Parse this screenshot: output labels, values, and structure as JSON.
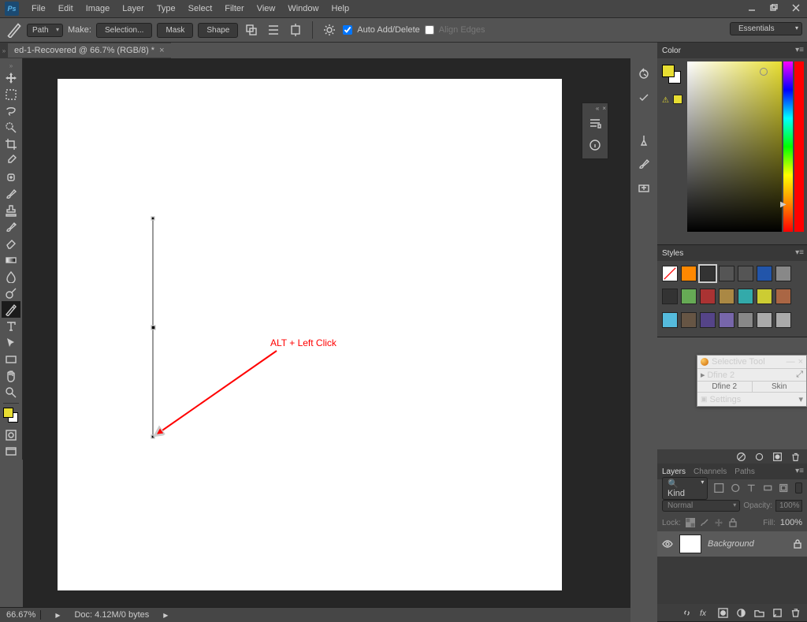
{
  "app": {
    "logo": "Ps"
  },
  "menu": [
    "File",
    "Edit",
    "Image",
    "Layer",
    "Type",
    "Select",
    "Filter",
    "View",
    "Window",
    "Help"
  ],
  "options": {
    "path_mode": "Path",
    "make_label": "Make:",
    "selection_btn": "Selection...",
    "mask_btn": "Mask",
    "shape_btn": "Shape",
    "auto_add_delete": "Auto Add/Delete",
    "align_edges": "Align Edges"
  },
  "workspace": "Essentials",
  "document": {
    "tab_title": "ed-1-Recovered @ 66.7% (RGB/8) *"
  },
  "annotation": {
    "label": "ALT + Left Click"
  },
  "panels": {
    "color_tab": "Color",
    "styles_tab": "Styles",
    "layers_tabs": [
      "Layers",
      "Channels",
      "Paths"
    ],
    "kind": "Kind",
    "blend_mode": "Normal",
    "opacity_label": "Opacity:",
    "opacity_value": "100%",
    "lock_label": "Lock:",
    "fill_label": "Fill:",
    "fill_value": "100%",
    "layer_name": "Background"
  },
  "selective": {
    "title": "Selective Tool",
    "product": "Dfine 2",
    "tab1": "Dfine 2",
    "tab2": "Skin",
    "settings": "Settings"
  },
  "status": {
    "zoom": "66.67%",
    "doc": "Doc: 4.12M/0 bytes"
  },
  "style_swatches": [
    "#fff",
    "#f80",
    "#333",
    "#555",
    "#555",
    "#25a",
    "#888",
    "#333",
    "#6a5",
    "#a33",
    "#a84",
    "#3aa",
    "#cc3",
    "#a64",
    "#5bd",
    "#654",
    "#548",
    "#76a",
    "#888",
    "#aaa",
    "#aaa"
  ]
}
